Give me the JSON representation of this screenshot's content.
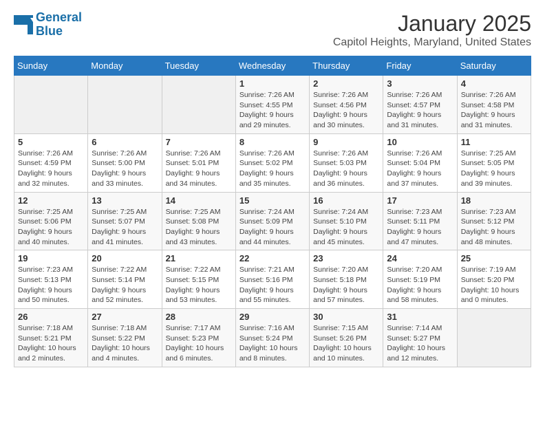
{
  "header": {
    "logo_line1": "General",
    "logo_line2": "Blue",
    "month": "January 2025",
    "location": "Capitol Heights, Maryland, United States"
  },
  "weekdays": [
    "Sunday",
    "Monday",
    "Tuesday",
    "Wednesday",
    "Thursday",
    "Friday",
    "Saturday"
  ],
  "weeks": [
    [
      {
        "day": "",
        "info": ""
      },
      {
        "day": "",
        "info": ""
      },
      {
        "day": "",
        "info": ""
      },
      {
        "day": "1",
        "info": "Sunrise: 7:26 AM\nSunset: 4:55 PM\nDaylight: 9 hours\nand 29 minutes."
      },
      {
        "day": "2",
        "info": "Sunrise: 7:26 AM\nSunset: 4:56 PM\nDaylight: 9 hours\nand 30 minutes."
      },
      {
        "day": "3",
        "info": "Sunrise: 7:26 AM\nSunset: 4:57 PM\nDaylight: 9 hours\nand 31 minutes."
      },
      {
        "day": "4",
        "info": "Sunrise: 7:26 AM\nSunset: 4:58 PM\nDaylight: 9 hours\nand 31 minutes."
      }
    ],
    [
      {
        "day": "5",
        "info": "Sunrise: 7:26 AM\nSunset: 4:59 PM\nDaylight: 9 hours\nand 32 minutes."
      },
      {
        "day": "6",
        "info": "Sunrise: 7:26 AM\nSunset: 5:00 PM\nDaylight: 9 hours\nand 33 minutes."
      },
      {
        "day": "7",
        "info": "Sunrise: 7:26 AM\nSunset: 5:01 PM\nDaylight: 9 hours\nand 34 minutes."
      },
      {
        "day": "8",
        "info": "Sunrise: 7:26 AM\nSunset: 5:02 PM\nDaylight: 9 hours\nand 35 minutes."
      },
      {
        "day": "9",
        "info": "Sunrise: 7:26 AM\nSunset: 5:03 PM\nDaylight: 9 hours\nand 36 minutes."
      },
      {
        "day": "10",
        "info": "Sunrise: 7:26 AM\nSunset: 5:04 PM\nDaylight: 9 hours\nand 37 minutes."
      },
      {
        "day": "11",
        "info": "Sunrise: 7:25 AM\nSunset: 5:05 PM\nDaylight: 9 hours\nand 39 minutes."
      }
    ],
    [
      {
        "day": "12",
        "info": "Sunrise: 7:25 AM\nSunset: 5:06 PM\nDaylight: 9 hours\nand 40 minutes."
      },
      {
        "day": "13",
        "info": "Sunrise: 7:25 AM\nSunset: 5:07 PM\nDaylight: 9 hours\nand 41 minutes."
      },
      {
        "day": "14",
        "info": "Sunrise: 7:25 AM\nSunset: 5:08 PM\nDaylight: 9 hours\nand 43 minutes."
      },
      {
        "day": "15",
        "info": "Sunrise: 7:24 AM\nSunset: 5:09 PM\nDaylight: 9 hours\nand 44 minutes."
      },
      {
        "day": "16",
        "info": "Sunrise: 7:24 AM\nSunset: 5:10 PM\nDaylight: 9 hours\nand 45 minutes."
      },
      {
        "day": "17",
        "info": "Sunrise: 7:23 AM\nSunset: 5:11 PM\nDaylight: 9 hours\nand 47 minutes."
      },
      {
        "day": "18",
        "info": "Sunrise: 7:23 AM\nSunset: 5:12 PM\nDaylight: 9 hours\nand 48 minutes."
      }
    ],
    [
      {
        "day": "19",
        "info": "Sunrise: 7:23 AM\nSunset: 5:13 PM\nDaylight: 9 hours\nand 50 minutes."
      },
      {
        "day": "20",
        "info": "Sunrise: 7:22 AM\nSunset: 5:14 PM\nDaylight: 9 hours\nand 52 minutes."
      },
      {
        "day": "21",
        "info": "Sunrise: 7:22 AM\nSunset: 5:15 PM\nDaylight: 9 hours\nand 53 minutes."
      },
      {
        "day": "22",
        "info": "Sunrise: 7:21 AM\nSunset: 5:16 PM\nDaylight: 9 hours\nand 55 minutes."
      },
      {
        "day": "23",
        "info": "Sunrise: 7:20 AM\nSunset: 5:18 PM\nDaylight: 9 hours\nand 57 minutes."
      },
      {
        "day": "24",
        "info": "Sunrise: 7:20 AM\nSunset: 5:19 PM\nDaylight: 9 hours\nand 58 minutes."
      },
      {
        "day": "25",
        "info": "Sunrise: 7:19 AM\nSunset: 5:20 PM\nDaylight: 10 hours\nand 0 minutes."
      }
    ],
    [
      {
        "day": "26",
        "info": "Sunrise: 7:18 AM\nSunset: 5:21 PM\nDaylight: 10 hours\nand 2 minutes."
      },
      {
        "day": "27",
        "info": "Sunrise: 7:18 AM\nSunset: 5:22 PM\nDaylight: 10 hours\nand 4 minutes."
      },
      {
        "day": "28",
        "info": "Sunrise: 7:17 AM\nSunset: 5:23 PM\nDaylight: 10 hours\nand 6 minutes."
      },
      {
        "day": "29",
        "info": "Sunrise: 7:16 AM\nSunset: 5:24 PM\nDaylight: 10 hours\nand 8 minutes."
      },
      {
        "day": "30",
        "info": "Sunrise: 7:15 AM\nSunset: 5:26 PM\nDaylight: 10 hours\nand 10 minutes."
      },
      {
        "day": "31",
        "info": "Sunrise: 7:14 AM\nSunset: 5:27 PM\nDaylight: 10 hours\nand 12 minutes."
      },
      {
        "day": "",
        "info": ""
      }
    ]
  ]
}
